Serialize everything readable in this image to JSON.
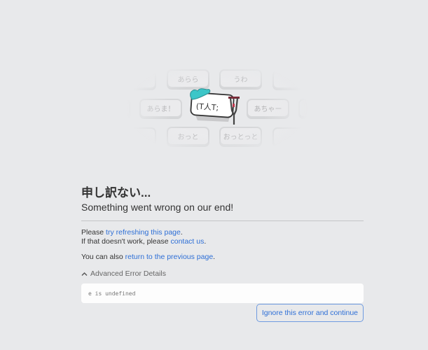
{
  "illustration": {
    "keys": [
      "あらら",
      "うわ",
      "あらま！",
      "あちゃー",
      "おっと",
      "おっとっと"
    ],
    "mascot_face": "(T人T;"
  },
  "error": {
    "title": "申し訳ない...",
    "subtitle": "Something went wrong on our end!",
    "line1_prefix": "Please ",
    "refresh_link": "try refreshing this page",
    "line1_suffix": ".",
    "line2_prefix": "If that doesn't work, please ",
    "contact_link": "contact us",
    "line2_suffix": ".",
    "line3_prefix": "You can also ",
    "previous_link": "return to the previous page",
    "line3_suffix": ".",
    "advanced_label": "Advanced Error Details",
    "error_message": "e is undefined",
    "ignore_button": "Ignore this error and continue"
  },
  "colors": {
    "link": "#2e6fd6",
    "background": "#e8e9eb",
    "mascot_accent": "#3cc6c8"
  }
}
